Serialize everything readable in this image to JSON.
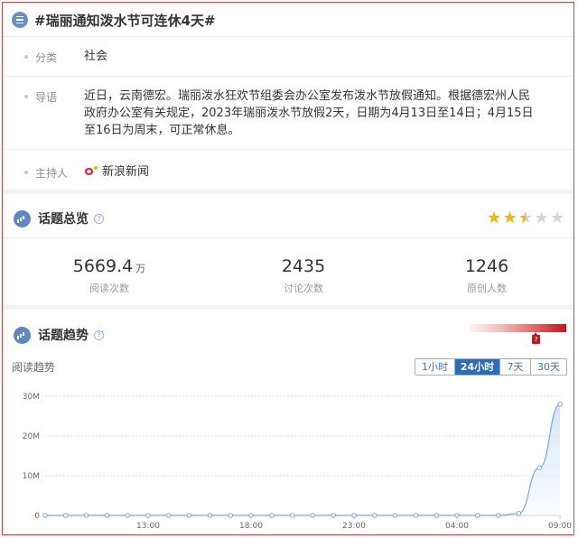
{
  "topic": {
    "title": "#瑞丽通知泼水节可连休4天#",
    "category_label": "分类",
    "category_value": "社会",
    "intro_label": "导语",
    "intro_lines": [
      "近日，云南德宏。瑞丽泼水狂欢节组委会办公室发布泼水节放假通知。根据德宏州人民",
      "政府办公室有关规定，2023年瑞丽泼水节放假2天，日期为4月13日至14日；4月15日",
      "至16日为周末，可正常休息。"
    ],
    "host_label": "主持人",
    "host_value": "新浪新闻",
    "host_logo_icon": "sina-weibo-logo-icon"
  },
  "overview": {
    "title": "话题总览",
    "help_glyph": "?",
    "rating_stars": 2.5,
    "rating_max": 5,
    "star_color": "#f7b500",
    "stats": [
      {
        "value": "5669.4",
        "unit": "万",
        "label": "阅读次数"
      },
      {
        "value": "2435",
        "unit": "",
        "label": "讨论次数"
      },
      {
        "value": "1246",
        "unit": "",
        "label": "原创人数"
      }
    ]
  },
  "trend": {
    "title": "话题趋势",
    "help_glyph": "?",
    "heat_level": "7",
    "heat_color": "#c9161d",
    "read_trend_label": "阅读趋势",
    "range_tabs": [
      {
        "label": "1小时",
        "active": false
      },
      {
        "label": "24小时",
        "active": true
      },
      {
        "label": "7天",
        "active": false
      },
      {
        "label": "30天",
        "active": false
      }
    ]
  },
  "chart_data": {
    "type": "area",
    "x_ticks": [
      "13:00",
      "18:00",
      "23:00",
      "04:00",
      "09:00"
    ],
    "y_ticks": [
      "30M",
      "20M",
      "10M",
      "0"
    ],
    "ylim": [
      0,
      30
    ],
    "y_unit": "M",
    "line_color": "#7aa8dc",
    "series": [
      {
        "x_hours": [
          8,
          9,
          10,
          11,
          12,
          13,
          14,
          15,
          16,
          17,
          18,
          19,
          20,
          21,
          22,
          23,
          24,
          25,
          26,
          27,
          28,
          29,
          30,
          31,
          32,
          33
        ],
        "values": [
          0,
          0,
          0,
          0,
          0,
          0,
          0,
          0,
          0,
          0,
          0,
          0,
          0,
          0,
          0,
          0,
          0,
          0,
          0,
          0,
          0,
          0,
          0,
          0.5,
          12,
          28
        ]
      }
    ]
  }
}
